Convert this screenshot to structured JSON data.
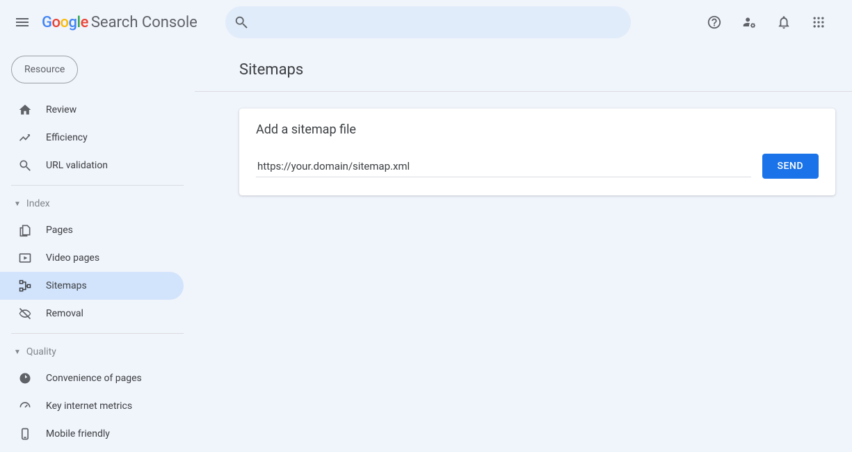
{
  "header": {
    "brand_suffix": "Search Console"
  },
  "sidebar": {
    "resource_chip": "Resource",
    "top_items": [
      {
        "label": "Review",
        "icon": "home-icon"
      },
      {
        "label": "Efficiency",
        "icon": "trend-icon"
      },
      {
        "label": "URL validation",
        "icon": "search-icon"
      }
    ],
    "sections": [
      {
        "label": "Index",
        "items": [
          {
            "label": "Pages",
            "icon": "pages-icon"
          },
          {
            "label": "Video pages",
            "icon": "video-icon"
          },
          {
            "label": "Sitemaps",
            "icon": "sitemaps-icon",
            "active": true
          },
          {
            "label": "Removal",
            "icon": "removal-icon"
          }
        ]
      },
      {
        "label": "Quality",
        "items": [
          {
            "label": "Convenience of pages",
            "icon": "convenience-icon"
          },
          {
            "label": "Key internet metrics",
            "icon": "metrics-icon"
          },
          {
            "label": "Mobile friendly",
            "icon": "mobile-icon"
          }
        ]
      }
    ]
  },
  "main": {
    "title": "Sitemaps",
    "card": {
      "title": "Add a sitemap file",
      "input_value": "https://your.domain/sitemap.xml",
      "send_label": "SEND"
    }
  }
}
